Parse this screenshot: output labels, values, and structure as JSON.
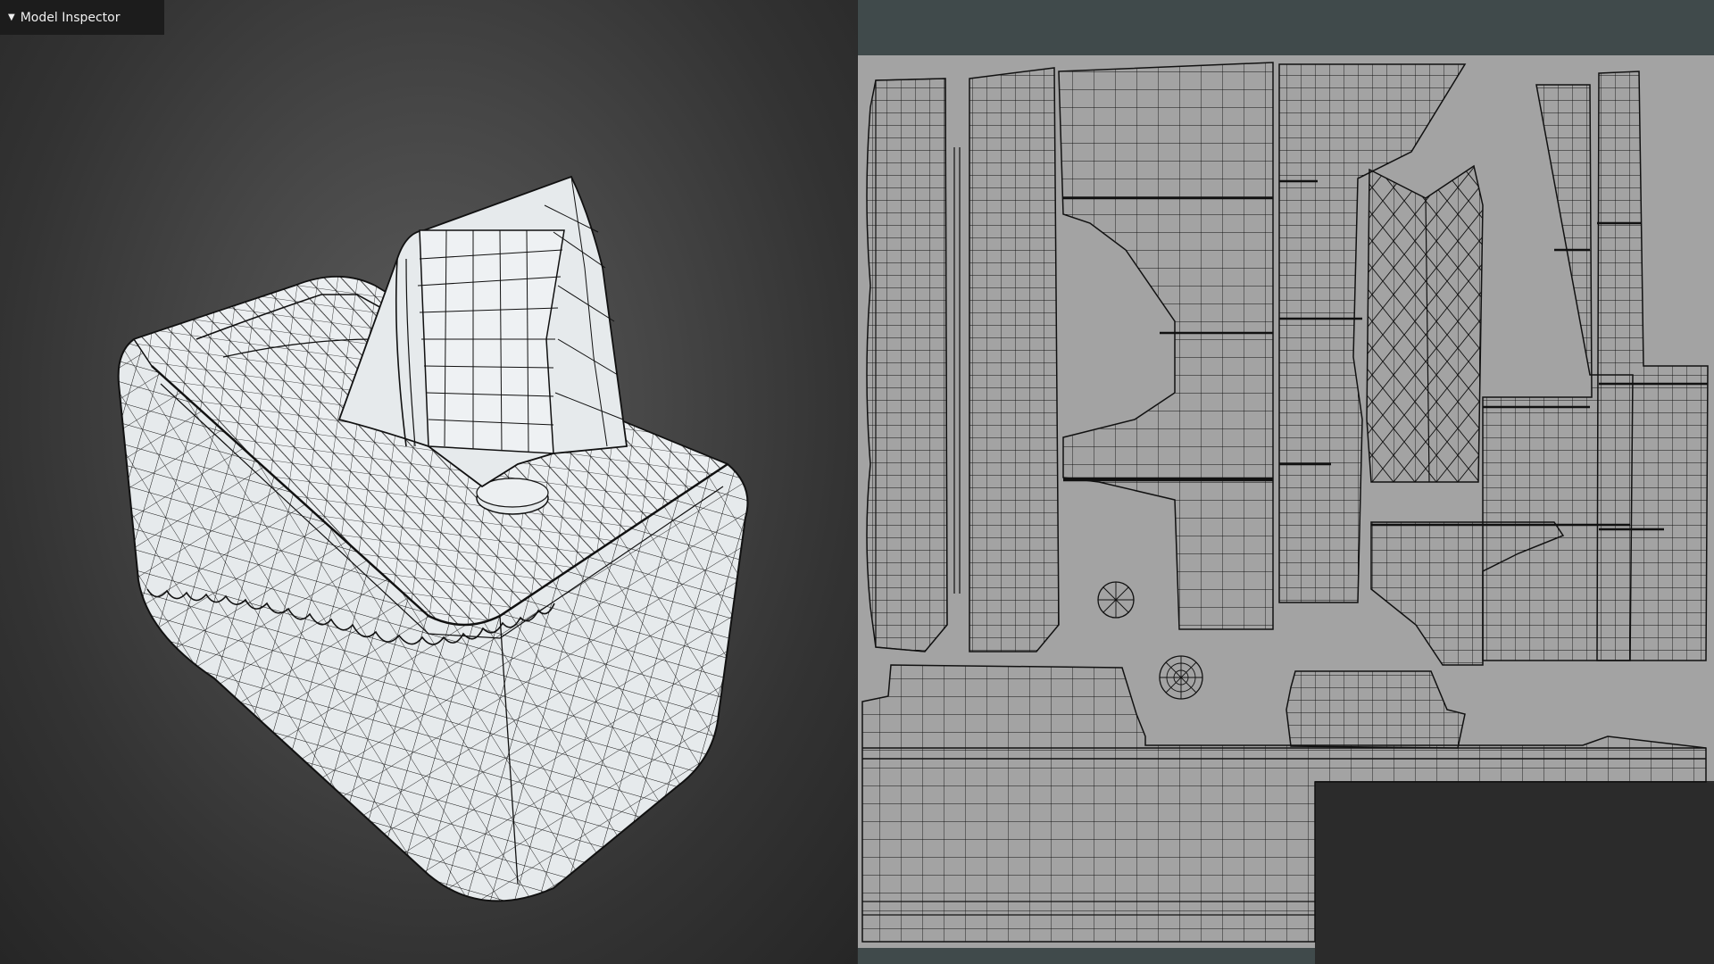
{
  "viewport_3d": {
    "inspector_label": "Model Inspector",
    "inspector_toggle_icon": "triangle-down-icon"
  },
  "uv_editor": {
    "background_color": "#404a4b",
    "canvas_color": "#a3a3a3"
  },
  "colors": {
    "mesh_fill": "#e6eaec",
    "wire": "#111111",
    "viewport_bg_center": "#5b5b5b",
    "viewport_bg_edge": "#262626"
  }
}
